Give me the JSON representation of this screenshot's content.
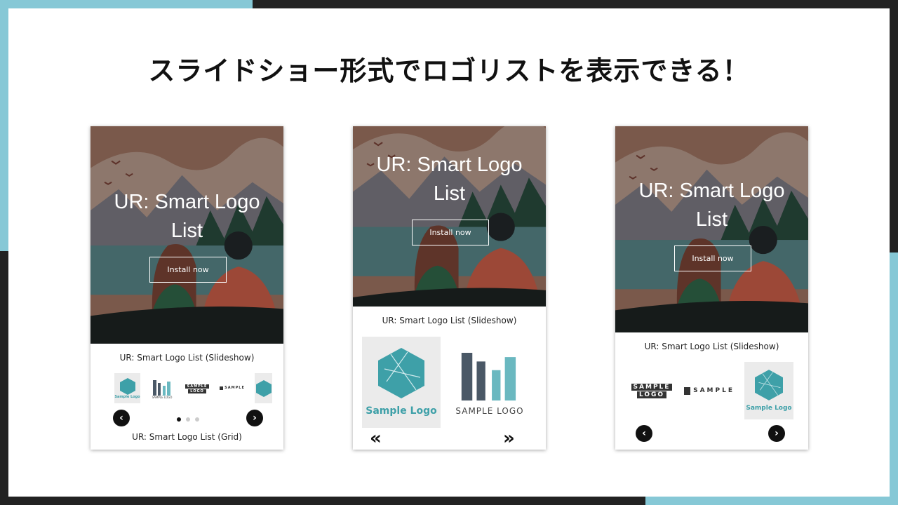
{
  "headline": "スライドショー形式でロゴリストを表示できる！",
  "colors": {
    "accent": "#86c8d6",
    "frame": "#222222",
    "logo_teal": "#3ea0a8"
  },
  "hero": {
    "title_line1": "UR: Smart Logo",
    "title_line2": "List",
    "install_label": "Install now"
  },
  "section": {
    "slideshow_title": "UR: Smart Logo List (Slideshow)",
    "grid_title": "UR: Smart Logo List (Grid)"
  },
  "logos": {
    "hex_caption": "Sample Logo",
    "m_caption": "SAMPLE LOGO",
    "box_line1": "SAMPLE",
    "box_line2": "LOGO",
    "square_text": "SAMPLE"
  },
  "nav": {
    "prev": "‹",
    "next": "›",
    "prev_double": "«",
    "next_double": "»"
  },
  "pagination": {
    "pages": 3,
    "current": 1
  }
}
